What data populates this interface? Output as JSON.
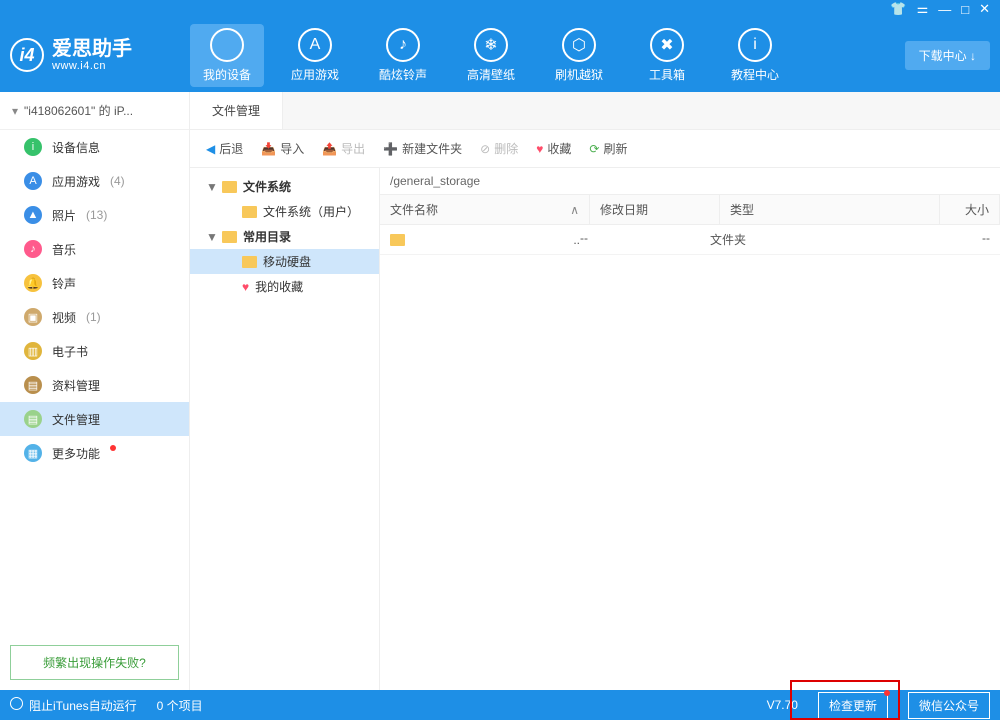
{
  "brand": {
    "name": "爱思助手",
    "site": "www.i4.cn",
    "badge": "i4"
  },
  "download_center": "下载中心 ↓",
  "nav": [
    {
      "label": "我的设备",
      "glyph": ""
    },
    {
      "label": "应用游戏",
      "glyph": "A"
    },
    {
      "label": "酷炫铃声",
      "glyph": "♪"
    },
    {
      "label": "高清壁纸",
      "glyph": "❄"
    },
    {
      "label": "刷机越狱",
      "glyph": "⬡"
    },
    {
      "label": "工具箱",
      "glyph": "✖"
    },
    {
      "label": "教程中心",
      "glyph": "i"
    }
  ],
  "device_label": "\"i418062601\" 的 iP...",
  "sidebar": [
    {
      "label": "设备信息",
      "count": "",
      "color": "#36c26b",
      "glyph": "i"
    },
    {
      "label": "应用游戏",
      "count": "(4)",
      "color": "#3a8ee6",
      "glyph": "A"
    },
    {
      "label": "照片",
      "count": "(13)",
      "color": "#3a8ee6",
      "glyph": "▲"
    },
    {
      "label": "音乐",
      "count": "",
      "color": "#ff5a8c",
      "glyph": "♪"
    },
    {
      "label": "铃声",
      "count": "",
      "color": "#f7c23e",
      "glyph": "🔔"
    },
    {
      "label": "视频",
      "count": "(1)",
      "color": "#cfa96c",
      "glyph": "▣"
    },
    {
      "label": "电子书",
      "count": "",
      "color": "#e0b53c",
      "glyph": "▥"
    },
    {
      "label": "资料管理",
      "count": "",
      "color": "#b98f4d",
      "glyph": "▤"
    },
    {
      "label": "文件管理",
      "count": "",
      "color": "#9ad28b",
      "glyph": "▤"
    },
    {
      "label": "更多功能",
      "count": "",
      "color": "#53b2e8",
      "glyph": "▦"
    }
  ],
  "sidebar_active_index": 8,
  "sidebar_reddot_index": 9,
  "side_help": "频繁出现操作失败?",
  "tab_label": "文件管理",
  "toolbar": {
    "back": "后退",
    "import": "导入",
    "export": "导出",
    "newfolder": "新建文件夹",
    "delete": "删除",
    "fav": "收藏",
    "refresh": "刷新"
  },
  "tree": [
    {
      "label": "文件系统",
      "depth": 0,
      "twisty": "▼",
      "bold": true
    },
    {
      "label": "文件系统（用户）",
      "depth": 1,
      "twisty": ""
    },
    {
      "label": "常用目录",
      "depth": 0,
      "twisty": "▼",
      "bold": true
    },
    {
      "label": "移动硬盘",
      "depth": 1,
      "twisty": "",
      "selected": true
    },
    {
      "label": "我的收藏",
      "depth": 1,
      "twisty": "",
      "heart": true
    }
  ],
  "path": "/general_storage",
  "columns": {
    "name": "文件名称",
    "date": "修改日期",
    "type": "类型",
    "size": "大小"
  },
  "rows": [
    {
      "name": "..",
      "date": "--",
      "type": "文件夹",
      "size": "--"
    }
  ],
  "footer": {
    "itunes": "阻止iTunes自动运行",
    "count": "0 个项目",
    "version": "V7.70",
    "update": "检查更新",
    "wechat": "微信公众号"
  }
}
